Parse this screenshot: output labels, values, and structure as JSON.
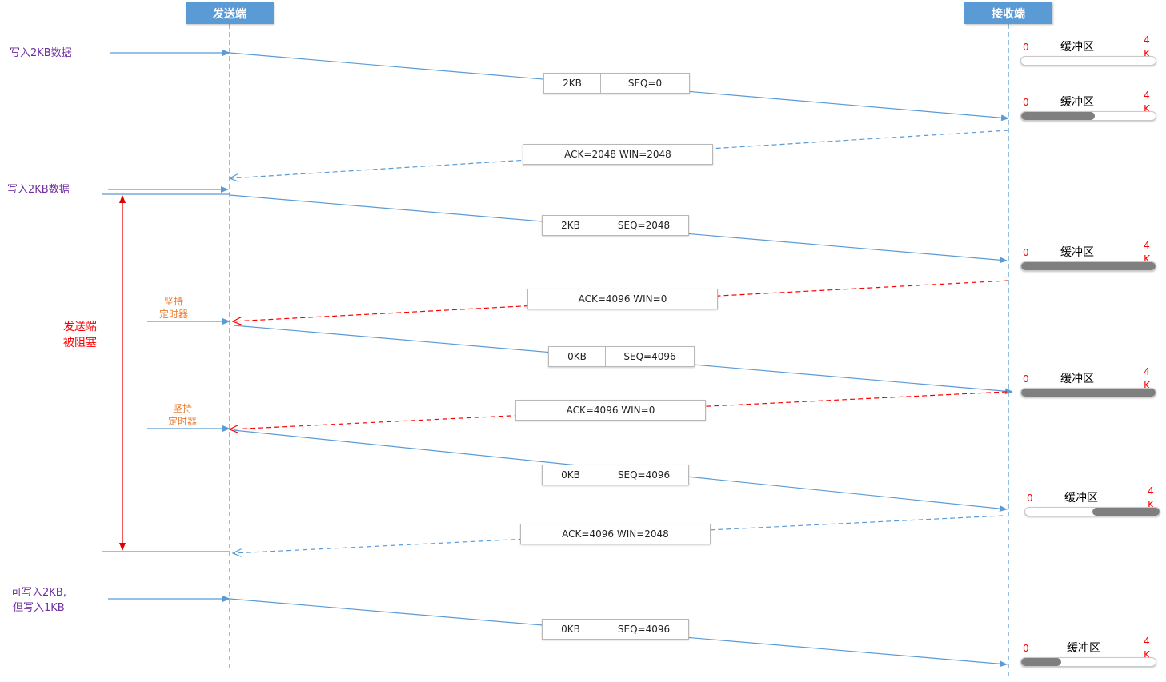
{
  "actors": {
    "sender": "发送端",
    "receiver": "接收端"
  },
  "left_labels": {
    "write1": "写入2KB数据",
    "write2": "写入2KB数据",
    "write3_line1": "可写入2KB,",
    "write3_line2": "但写入1KB"
  },
  "blocked": {
    "line1": "发送端",
    "line2": "被阻塞"
  },
  "timer": {
    "line1": "坚持",
    "line2": "定时器"
  },
  "segments": [
    {
      "size": "2KB",
      "seq": "SEQ=0"
    },
    {
      "size": "2KB",
      "seq": "SEQ=2048"
    },
    {
      "size": "0KB",
      "seq": "SEQ=4096"
    },
    {
      "size": "0KB",
      "seq": "SEQ=4096"
    },
    {
      "size": "0KB",
      "seq": "SEQ=4096"
    }
  ],
  "acks": [
    {
      "text": "ACK=2048 WIN=2048",
      "style": "blue-dashed"
    },
    {
      "text": "ACK=4096 WIN=0",
      "style": "red-dashed"
    },
    {
      "text": "ACK=4096 WIN=0",
      "style": "red-dashed"
    },
    {
      "text": "ACK=4096 WIN=2048",
      "style": "blue-dashed"
    }
  ],
  "buffer_label": "缓冲区",
  "buffer_zero": "0",
  "buffer_cap_top": "4",
  "buffer_cap_bottom": "K",
  "buffers": [
    {
      "fill_start": 0,
      "fill_end": 0
    },
    {
      "fill_start": 0,
      "fill_end": 0.55
    },
    {
      "fill_start": 0,
      "fill_end": 1
    },
    {
      "fill_start": 0,
      "fill_end": 1
    },
    {
      "fill_start": 0.5,
      "fill_end": 1
    },
    {
      "fill_start": 0,
      "fill_end": 0.3
    }
  ],
  "colors": {
    "actor": "#5b9bd5",
    "data_line": "#5b9bd5",
    "ack_line": "#5b9bd5",
    "zero_window_line": "#ff0000",
    "label_purple": "#7030a0",
    "timer_orange": "#ed7d31",
    "buffer_fill": "#7f7f7f"
  }
}
